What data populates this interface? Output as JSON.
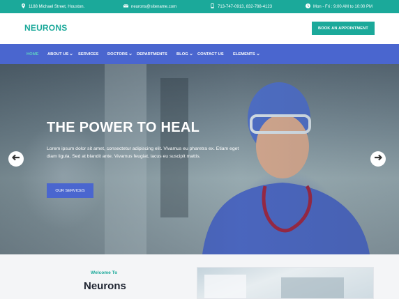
{
  "topbar": {
    "address": "1188 Michael Street, Houston.",
    "email": "neurons@sitename.com",
    "phone": "713-747-0913, 832-788-4123",
    "hours": "Mon - Fri : 9:00 AM to 10:00 PM"
  },
  "header": {
    "logo": "NEURONS",
    "appointment_button": "BOOK AN APPOINTMENT"
  },
  "nav": {
    "items": [
      {
        "label": "HOME",
        "active": true
      },
      {
        "label": "ABOUT US",
        "dropdown": true
      },
      {
        "label": "SERVICES"
      },
      {
        "label": "DOCTORS",
        "dropdown": true
      },
      {
        "label": "DEPARTMENTS"
      },
      {
        "label": "BLOG",
        "dropdown": true
      },
      {
        "label": "CONTACT US"
      },
      {
        "label": "ELEMENTS",
        "dropdown": true
      }
    ]
  },
  "hero": {
    "title": "THE POWER TO HEAL",
    "text": "Lorem ipsum dolor sit amet, consectetur adipiscing elit. Vivamus eu pharetra ex. Etiam eget diam ligula. Sed at blandit ante. Vivamus feugiat, lacus eu suscipit mattis.",
    "button": "OUR SERVICES"
  },
  "about": {
    "welcome": "Welcome To",
    "title": "Neurons"
  },
  "icons": {
    "address": "map-pin-icon",
    "email": "envelope-icon",
    "phone": "mobile-phone-icon",
    "hours": "clock-icon",
    "prev": "arrow-left-icon",
    "next": "arrow-right-icon"
  },
  "colors": {
    "teal": "#1ba99a",
    "nav_blue": "#4a66cf",
    "active_nav": "#5fd0c2"
  }
}
